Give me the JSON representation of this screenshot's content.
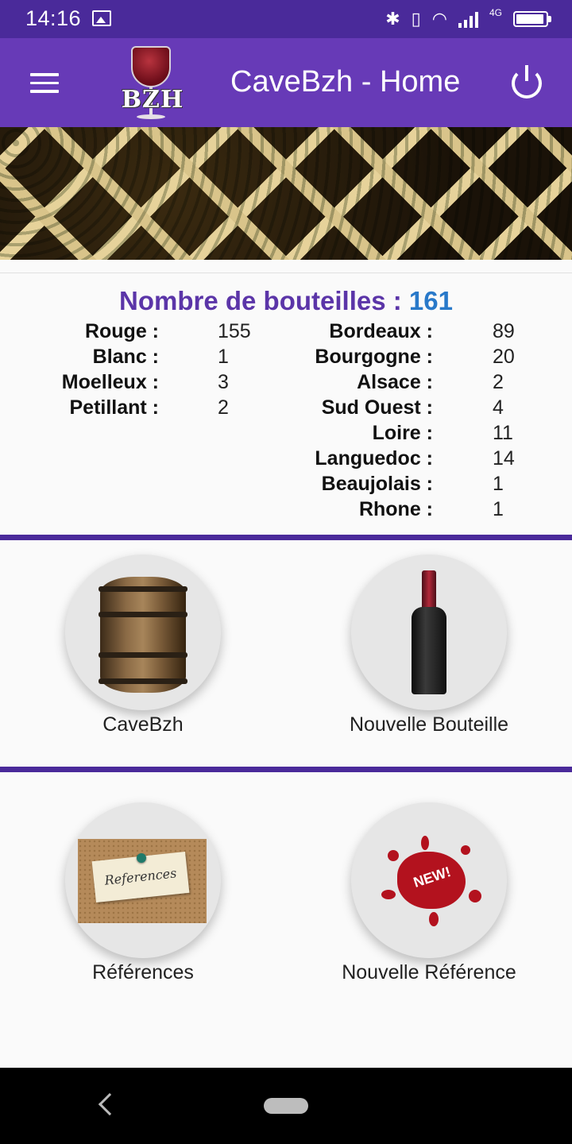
{
  "status": {
    "time": "14:16",
    "network": "4G"
  },
  "appbar": {
    "title": "CaveBzh - Home",
    "logo_text": "BZH"
  },
  "stats": {
    "title": "Nombre de bouteilles :",
    "total": "161",
    "types": [
      {
        "label": "Rouge :",
        "value": "155"
      },
      {
        "label": "Blanc :",
        "value": "1"
      },
      {
        "label": "Moelleux :",
        "value": "3"
      },
      {
        "label": "Petillant :",
        "value": "2"
      }
    ],
    "regions": [
      {
        "label": "Bordeaux :",
        "value": "89"
      },
      {
        "label": "Bourgogne :",
        "value": "20"
      },
      {
        "label": "Alsace :",
        "value": "2"
      },
      {
        "label": "Sud Ouest :",
        "value": "4"
      },
      {
        "label": "Loire :",
        "value": "11"
      },
      {
        "label": "Languedoc :",
        "value": "14"
      },
      {
        "label": "Beaujolais :",
        "value": "1"
      },
      {
        "label": "Rhone :",
        "value": "1"
      }
    ]
  },
  "actions": {
    "cave": "CaveBzh",
    "new_bottle": "Nouvelle Bouteille",
    "references": "Références",
    "new_reference": "Nouvelle Référence",
    "references_note": "References",
    "new_badge": "NEW!"
  },
  "colors": {
    "primary": "#673ab7",
    "primary_dark": "#4a2a9a",
    "accent_count": "#2979c9"
  }
}
